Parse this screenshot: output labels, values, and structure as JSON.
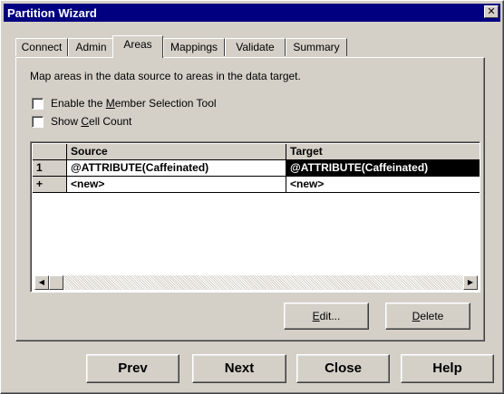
{
  "window": {
    "title": "Partition Wizard",
    "close_glyph": "✕"
  },
  "tabs": [
    {
      "label": "Connect",
      "active": false
    },
    {
      "label": "Admin",
      "active": false
    },
    {
      "label": "Areas",
      "active": true
    },
    {
      "label": "Mappings",
      "active": false
    },
    {
      "label": "Validate",
      "active": false
    },
    {
      "label": "Summary",
      "active": false
    }
  ],
  "areas": {
    "description": "Map areas in the data source to areas in the data target.",
    "options": [
      {
        "pre": "Enable the ",
        "key": "M",
        "post": "ember Selection Tool",
        "checked": false
      },
      {
        "pre": "Show ",
        "key": "C",
        "post": "ell Count",
        "checked": false
      }
    ],
    "grid": {
      "columns": [
        "",
        "Source",
        "Target"
      ],
      "rows": [
        {
          "id": "1",
          "source": "@ATTRIBUTE(Caffeinated)",
          "target": "@ATTRIBUTE(Caffeinated)",
          "selected_column": "target"
        },
        {
          "id": "+",
          "source": "<new>",
          "target": "<new>"
        }
      ],
      "scroll": {
        "left_glyph": "◀",
        "right_glyph": "▶"
      }
    },
    "buttons": {
      "edit": {
        "key": "E",
        "rest": "dit..."
      },
      "delete": {
        "key": "D",
        "rest": "elete"
      }
    }
  },
  "footer": {
    "prev": "Prev",
    "next": "Next",
    "close": "Close",
    "help": "Help"
  }
}
